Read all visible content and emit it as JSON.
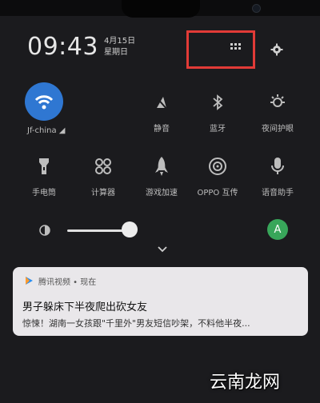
{
  "status": {
    "time": "09:43",
    "date_line1": "4月15日",
    "date_line2": "星期日"
  },
  "header": {
    "grid_icon": "grid-icon",
    "settings_icon": "gear-icon",
    "highlight_color": "#e23b37"
  },
  "tiles": [
    {
      "label": "Jf-china",
      "icon": "wifi-icon",
      "active": true,
      "color": "#2f77d2"
    },
    {
      "label": "静音",
      "icon": "mute-icon"
    },
    {
      "label": "蓝牙",
      "icon": "bluetooth-icon"
    },
    {
      "label": "夜间护眼",
      "icon": "night-mode-icon"
    },
    {
      "label": "手电筒",
      "icon": "flashlight-icon"
    },
    {
      "label": "计算器",
      "icon": "calculator-icon"
    },
    {
      "label": "游戏加速",
      "icon": "rocket-icon"
    },
    {
      "label": "OPPO 互传",
      "icon": "share-icon"
    },
    {
      "label": "语音助手",
      "icon": "microphone-icon"
    }
  ],
  "brightness": {
    "level": 0.38,
    "avatar_letter": "A",
    "avatar_color": "#38a65a"
  },
  "notification": {
    "app": "腾讯视频 • 现在",
    "title": "男子躲床下半夜爬出砍女友",
    "body": "惊悚！湖南一女孩跟\"千里外\"男友短信吵架，不料他半夜..."
  },
  "watermark": "云南龙网"
}
